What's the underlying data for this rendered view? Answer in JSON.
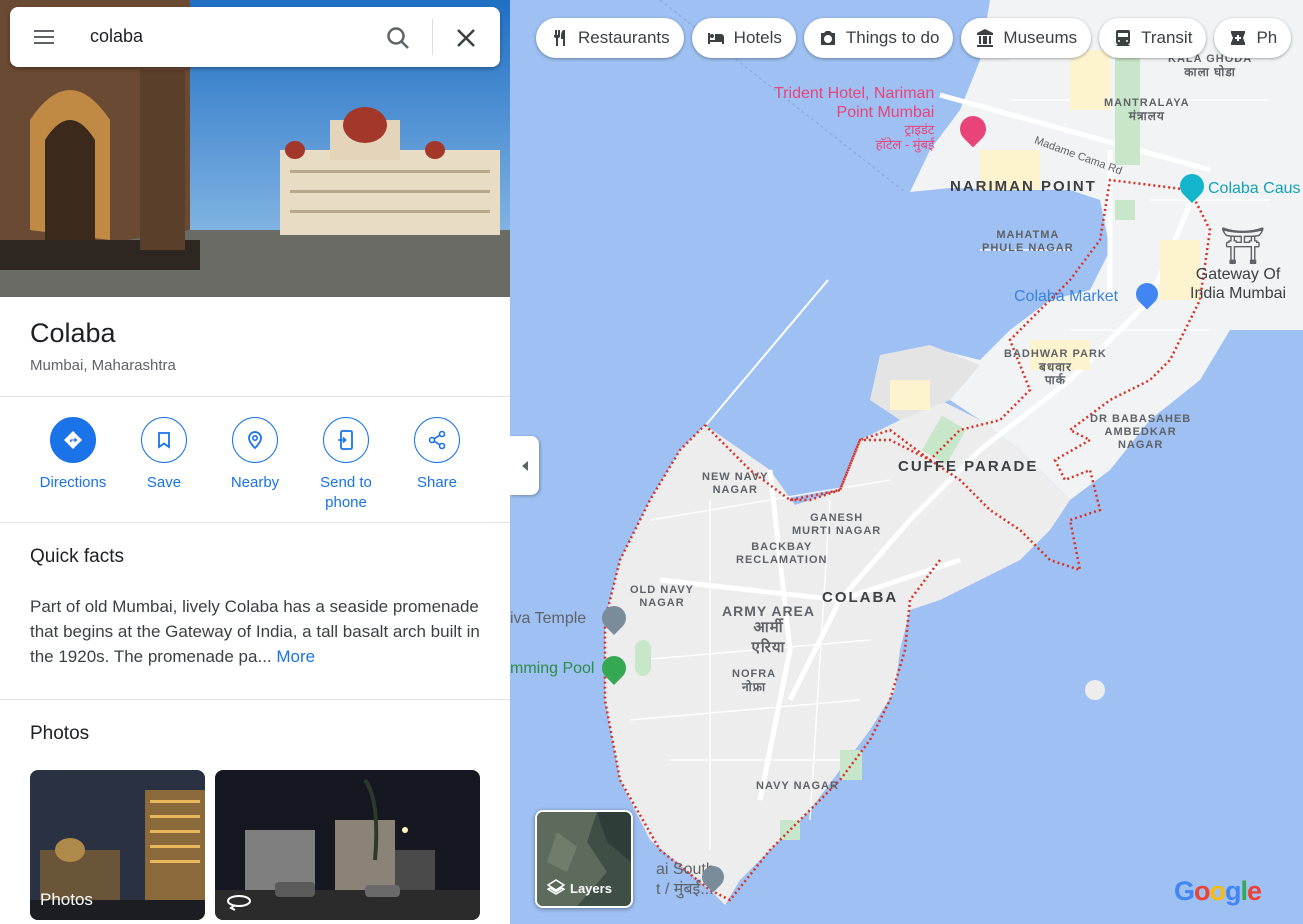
{
  "search": {
    "query": "colaba"
  },
  "place": {
    "title": "Colaba",
    "subtitle": "Mumbai, Maharashtra"
  },
  "actions": [
    {
      "label": "Directions"
    },
    {
      "label": "Save"
    },
    {
      "label": "Nearby"
    },
    {
      "label": "Send to phone"
    },
    {
      "label": "Share"
    }
  ],
  "quick_facts": {
    "title": "Quick facts",
    "text": "Part of old Mumbai, lively Colaba has a seaside promenade that begins at the Gateway of India, a tall basalt arch built in the 1920s. The promenade pa...",
    "more": "More"
  },
  "photos": {
    "title": "Photos",
    "first_label": "Photos"
  },
  "chips": [
    "Restaurants",
    "Hotels",
    "Things to do",
    "Museums",
    "Transit",
    "Ph"
  ],
  "map": {
    "layers_label": "Layers",
    "google": "Google",
    "labels": {
      "kala_ghoda": "KALA GHODA",
      "kala_ghoda_deva": "काला घोडा",
      "mantralaya": "MANTRALAYA",
      "mantralaya_deva": "मंत्रालय",
      "trident_1": "Trident Hotel, Nariman",
      "trident_2": "Point Mumbai",
      "trident_deva_1": "ट्राइडंट",
      "trident_deva_2": "हॉटेल - मुंबई",
      "madame_cama": "Madame Cama Rd",
      "nariman_point": "NARIMAN POINT",
      "colaba_causeway": "Colaba Caus",
      "mahatma_1": "MAHATMA",
      "mahatma_2": "PHULE NAGAR",
      "gateway_1": "Gateway Of",
      "gateway_2": "India Mumbai",
      "colaba_market": "Colaba Market",
      "badhwar": "BADHWAR PARK",
      "badhwar_deva_1": "बधवार",
      "badhwar_deva_2": "पार्क",
      "ambedkar_1": "DR BABASAHEB",
      "ambedkar_2": "AMBEDKAR",
      "ambedkar_3": "NAGAR",
      "cuffe": "CUFFE PARADE",
      "new_navy_1": "NEW NAVY",
      "new_navy_2": "NAGAR",
      "ganesh_1": "GANESH",
      "ganesh_2": "MURTI NAGAR",
      "backbay_1": "BACKBAY",
      "backbay_2": "RECLAMATION",
      "old_navy_1": "OLD NAVY",
      "old_navy_2": "NAGAR",
      "colaba": "COLABA",
      "army_area": "ARMY AREA",
      "army_deva_1": "आर्मी",
      "army_deva_2": "एरिया",
      "nofra": "NOFRA",
      "nofra_deva": "नोफ्रा",
      "temple": "iva Temple",
      "pool": "mming Pool",
      "navy_nagar": "NAVY NAGAR",
      "south_1": "ai South",
      "south_2": "t / मुंबई..."
    }
  },
  "colors": {
    "accent": "#1a73e8",
    "water": "#9ec0f2",
    "land": "#f1f3f4",
    "boundary": "#d93025"
  }
}
